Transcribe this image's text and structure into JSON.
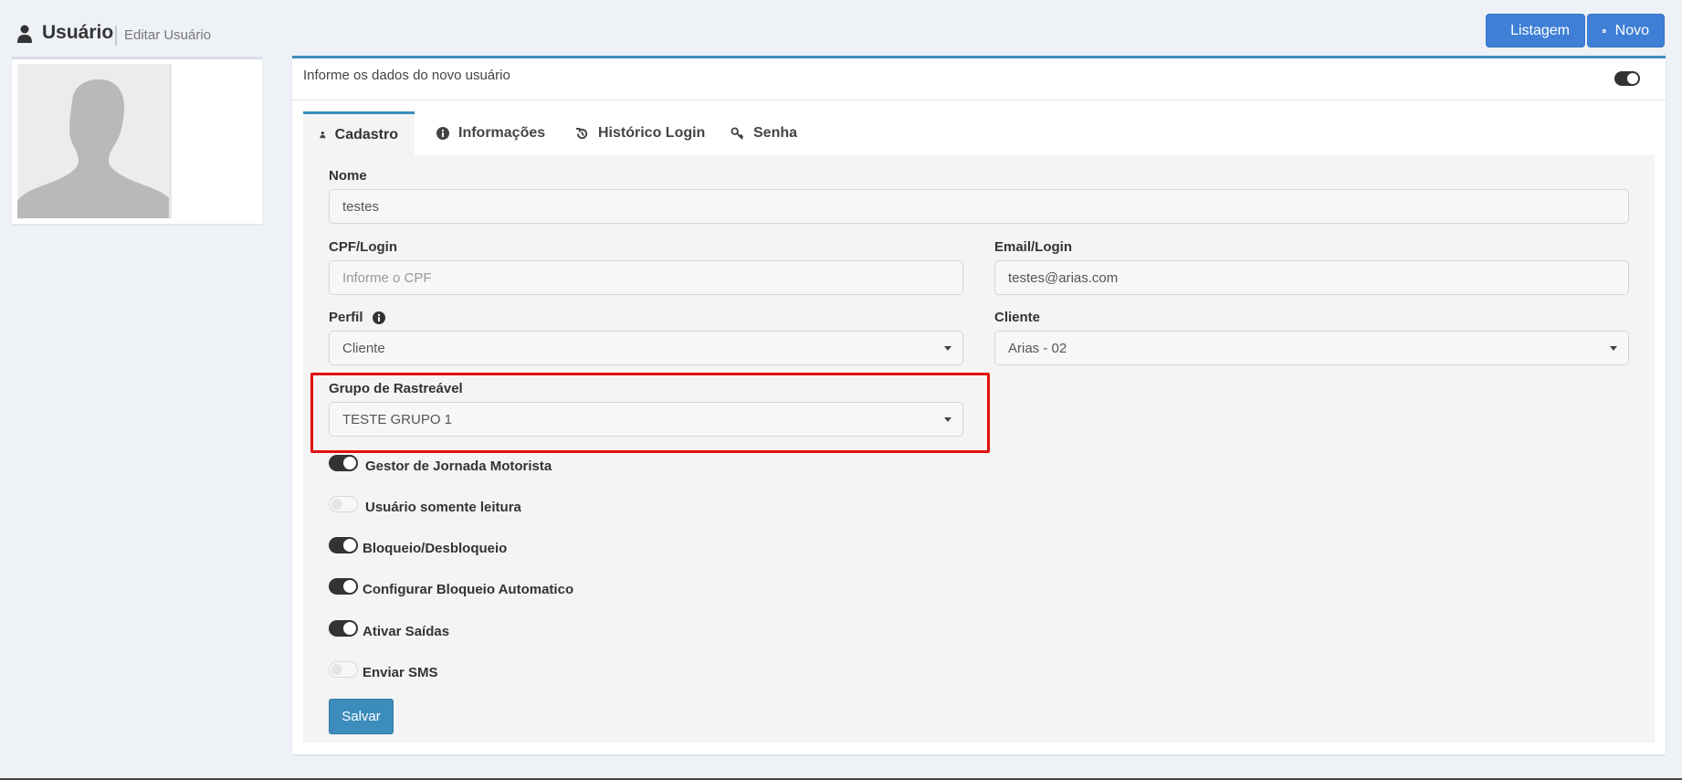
{
  "header": {
    "title": "Usuário",
    "subtitle": "Editar Usuário",
    "icon": "user-icon"
  },
  "actions": {
    "list_label": "Listagem",
    "list_icon": "list-icon",
    "new_label": "Novo",
    "new_icon": "plus-square-icon"
  },
  "card": {
    "title": "Informe os dados do novo usuário"
  },
  "tabs": [
    {
      "label": "Cadastro",
      "icon": "user-icon",
      "active": true
    },
    {
      "label": "Informações",
      "icon": "info-circle-icon",
      "active": false
    },
    {
      "label": "Histórico Login",
      "icon": "history-icon",
      "active": false
    },
    {
      "label": "Senha",
      "icon": "key-icon",
      "active": false
    }
  ],
  "form": {
    "nome": {
      "label": "Nome",
      "value": "testes"
    },
    "cpf": {
      "label": "CPF/Login",
      "placeholder": "Informe o CPF",
      "value": ""
    },
    "email": {
      "label": "Email/Login",
      "value": "testes@arias.com"
    },
    "perfil": {
      "label": "Perfil",
      "value": "Cliente"
    },
    "cliente": {
      "label": "Cliente",
      "value": "Arias - 02"
    },
    "grupo": {
      "label": "Grupo de Rastreável",
      "value": "TESTE GRUPO 1"
    },
    "toggles": [
      {
        "label": "Gestor de Jornada Motorista",
        "on": true
      },
      {
        "label": "Usuário somente leitura",
        "on": false
      },
      {
        "label": "Bloqueio/Desbloqueio",
        "on": true
      },
      {
        "label": "Configurar Bloqueio Automatico",
        "on": true
      },
      {
        "label": "Ativar Saídas",
        "on": true
      },
      {
        "label": "Enviar SMS",
        "on": false
      }
    ],
    "save_label": "Salvar"
  },
  "colors": {
    "primary": "#3c8dbc",
    "button_blue": "#3f7fd6",
    "highlight": "#e01010"
  }
}
